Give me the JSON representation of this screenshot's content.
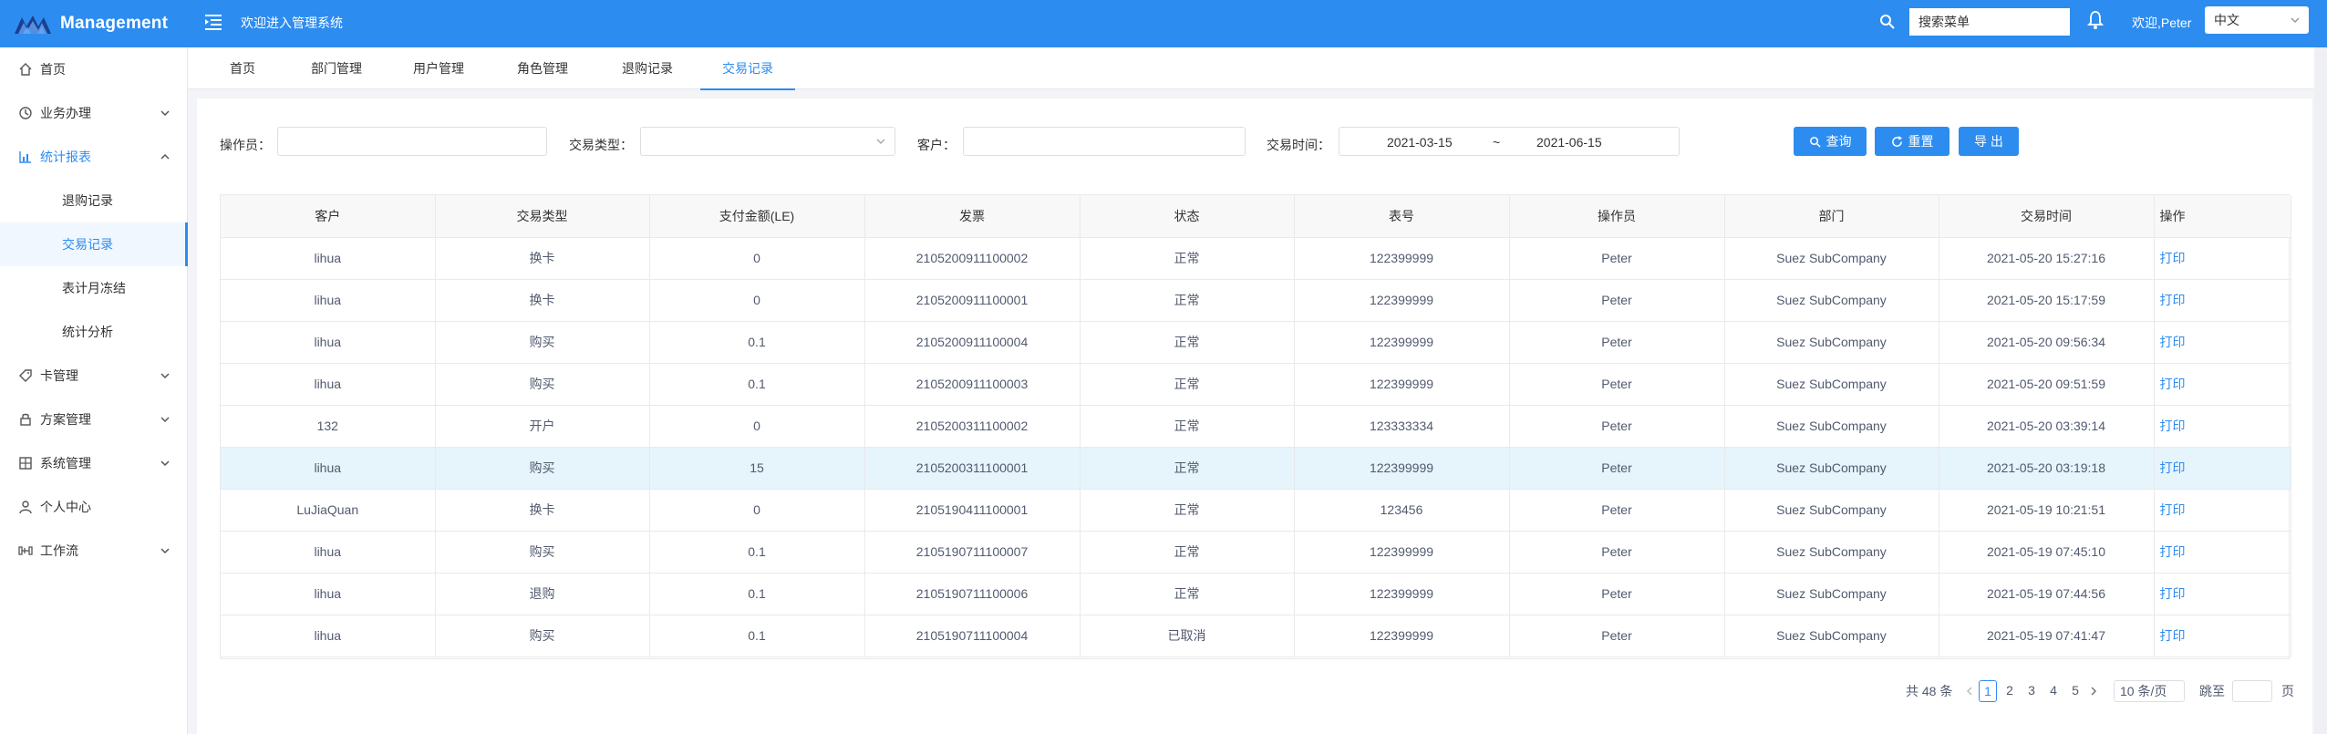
{
  "header": {
    "brand": "Management",
    "welcome_system": "欢迎进入管理系统",
    "search_placeholder": "搜索菜单",
    "welcome_user": "欢迎,Peter",
    "language": "中文",
    "accent_color": "#2d8cf0"
  },
  "sidebar": {
    "items": [
      {
        "label": "首页",
        "icon": "home-icon"
      },
      {
        "label": "业务办理",
        "icon": "clock-icon"
      },
      {
        "label": "统计报表",
        "icon": "bar-chart-icon"
      },
      {
        "label": "卡管理",
        "icon": "tag-icon"
      },
      {
        "label": "方案管理",
        "icon": "lock-icon"
      },
      {
        "label": "系统管理",
        "icon": "grid-icon"
      },
      {
        "label": "个人中心",
        "icon": "user-icon"
      },
      {
        "label": "工作流",
        "icon": "workflow-icon"
      }
    ],
    "sub_items": [
      {
        "label": "退购记录",
        "active": false
      },
      {
        "label": "交易记录",
        "active": true
      },
      {
        "label": "表计月冻结",
        "active": false
      },
      {
        "label": "统计分析",
        "active": false
      }
    ]
  },
  "tabs": [
    "首页",
    "部门管理",
    "用户管理",
    "角色管理",
    "退购记录",
    "交易记录"
  ],
  "filters": {
    "operator_label": "操作员：",
    "type_label": "交易类型：",
    "customer_label": "客户：",
    "time_label": "交易时间：",
    "date_start": "2021-03-15",
    "date_sep": "~",
    "date_end": "2021-06-15",
    "query_btn": "查询",
    "reset_btn": "重置",
    "export_btn": "导 出"
  },
  "table": {
    "columns": [
      "客户",
      "交易类型",
      "支付金额(LE)",
      "发票",
      "状态",
      "表号",
      "操作员",
      "部门",
      "交易时间",
      "操作"
    ],
    "rows": [
      [
        "lihua",
        "换卡",
        "0",
        "2105200911100002",
        "正常",
        "122399999",
        "Peter",
        "Suez SubCompany",
        "2021-05-20 15:27:16",
        "打印"
      ],
      [
        "lihua",
        "换卡",
        "0",
        "2105200911100001",
        "正常",
        "122399999",
        "Peter",
        "Suez SubCompany",
        "2021-05-20 15:17:59",
        "打印"
      ],
      [
        "lihua",
        "购买",
        "0.1",
        "2105200911100004",
        "正常",
        "122399999",
        "Peter",
        "Suez SubCompany",
        "2021-05-20 09:56:34",
        "打印"
      ],
      [
        "lihua",
        "购买",
        "0.1",
        "2105200911100003",
        "正常",
        "122399999",
        "Peter",
        "Suez SubCompany",
        "2021-05-20 09:51:59",
        "打印"
      ],
      [
        "132",
        "开户",
        "0",
        "2105200311100002",
        "正常",
        "123333334",
        "Peter",
        "Suez SubCompany",
        "2021-05-20 03:39:14",
        "打印"
      ],
      [
        "lihua",
        "购买",
        "15",
        "2105200311100001",
        "正常",
        "122399999",
        "Peter",
        "Suez SubCompany",
        "2021-05-20 03:19:18",
        "打印"
      ],
      [
        "LuJiaQuan",
        "换卡",
        "0",
        "2105190411100001",
        "正常",
        "123456",
        "Peter",
        "Suez SubCompany",
        "2021-05-19 10:21:51",
        "打印"
      ],
      [
        "lihua",
        "购买",
        "0.1",
        "2105190711100007",
        "正常",
        "122399999",
        "Peter",
        "Suez SubCompany",
        "2021-05-19 07:45:10",
        "打印"
      ],
      [
        "lihua",
        "退购",
        "0.1",
        "2105190711100006",
        "正常",
        "122399999",
        "Peter",
        "Suez SubCompany",
        "2021-05-19 07:44:56",
        "打印"
      ],
      [
        "lihua",
        "购买",
        "0.1",
        "2105190711100004",
        "已取消",
        "122399999",
        "Peter",
        "Suez SubCompany",
        "2021-05-19 07:41:47",
        "打印"
      ]
    ],
    "highlighted_row": 5
  },
  "pagination": {
    "total": "共 48 条",
    "pages": [
      "1",
      "2",
      "3",
      "4",
      "5"
    ],
    "current": "1",
    "page_size": "10 条/页",
    "jump_label": "跳至",
    "page_suffix": "页"
  }
}
